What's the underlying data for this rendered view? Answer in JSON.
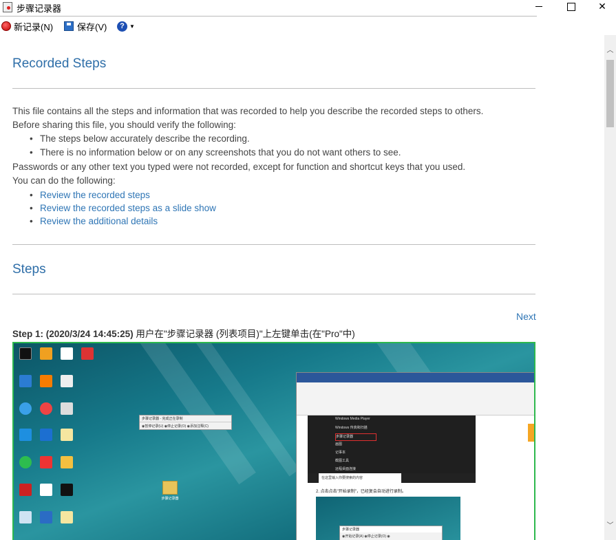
{
  "window": {
    "title": "步骤记录器"
  },
  "toolbar": {
    "new_recording": "新记录(N)",
    "save": "保存(V)",
    "help_glyph": "?"
  },
  "report": {
    "heading": "Recorded Steps",
    "intro_1": "This file contains all the steps and information that was recorded to help you describe the recorded steps to others.",
    "intro_2": "Before sharing this file, you should verify the following:",
    "verify_items": [
      "The steps below accurately describe the recording.",
      "There is no information below or on any screenshots that you do not want others to see."
    ],
    "intro_3": "Passwords or any other text you typed were not recorded, except for function and shortcut keys that you used.",
    "intro_4": "You can do the following:",
    "links": [
      "Review the recorded steps",
      "Review the recorded steps as a slide show",
      "Review the additional details"
    ],
    "steps_heading": "Steps",
    "next_link": "Next",
    "step1": {
      "label": "Step 1: (2020/3/24 14:45:25)",
      "description": " 用户在\"步骤记录器 (列表项目)\"上左键单击(在\"Pro\"中)"
    },
    "screenshot": {
      "mini_window_title": "步骤记录器 - 完成正在录制",
      "mini_window_buttons": "◉暂停记录(U)  ◉停止记录(O)  ◉添加注释(C)",
      "folder_label": "步骤记录器",
      "start_menu_items": [
        "Windows Media Player",
        "Windows 传真和扫描",
        "步骤记录器",
        "画图",
        "记事本",
        "截图工具",
        "远程桌面连接"
      ],
      "search_placeholder": "在这里输入你要搜索的内容",
      "doc_line": "2. 点击点击\"开始录制\"，已经复会自动进行录制。",
      "mini_recorder_title": "步骤记录器",
      "mini_recorder_buttons": "◉开始记录(A)  ◉停止记录(O)  ◉"
    }
  },
  "icons": {
    "record": "record-dot-icon",
    "save": "floppy-disk-icon",
    "help": "help-circle-icon"
  }
}
